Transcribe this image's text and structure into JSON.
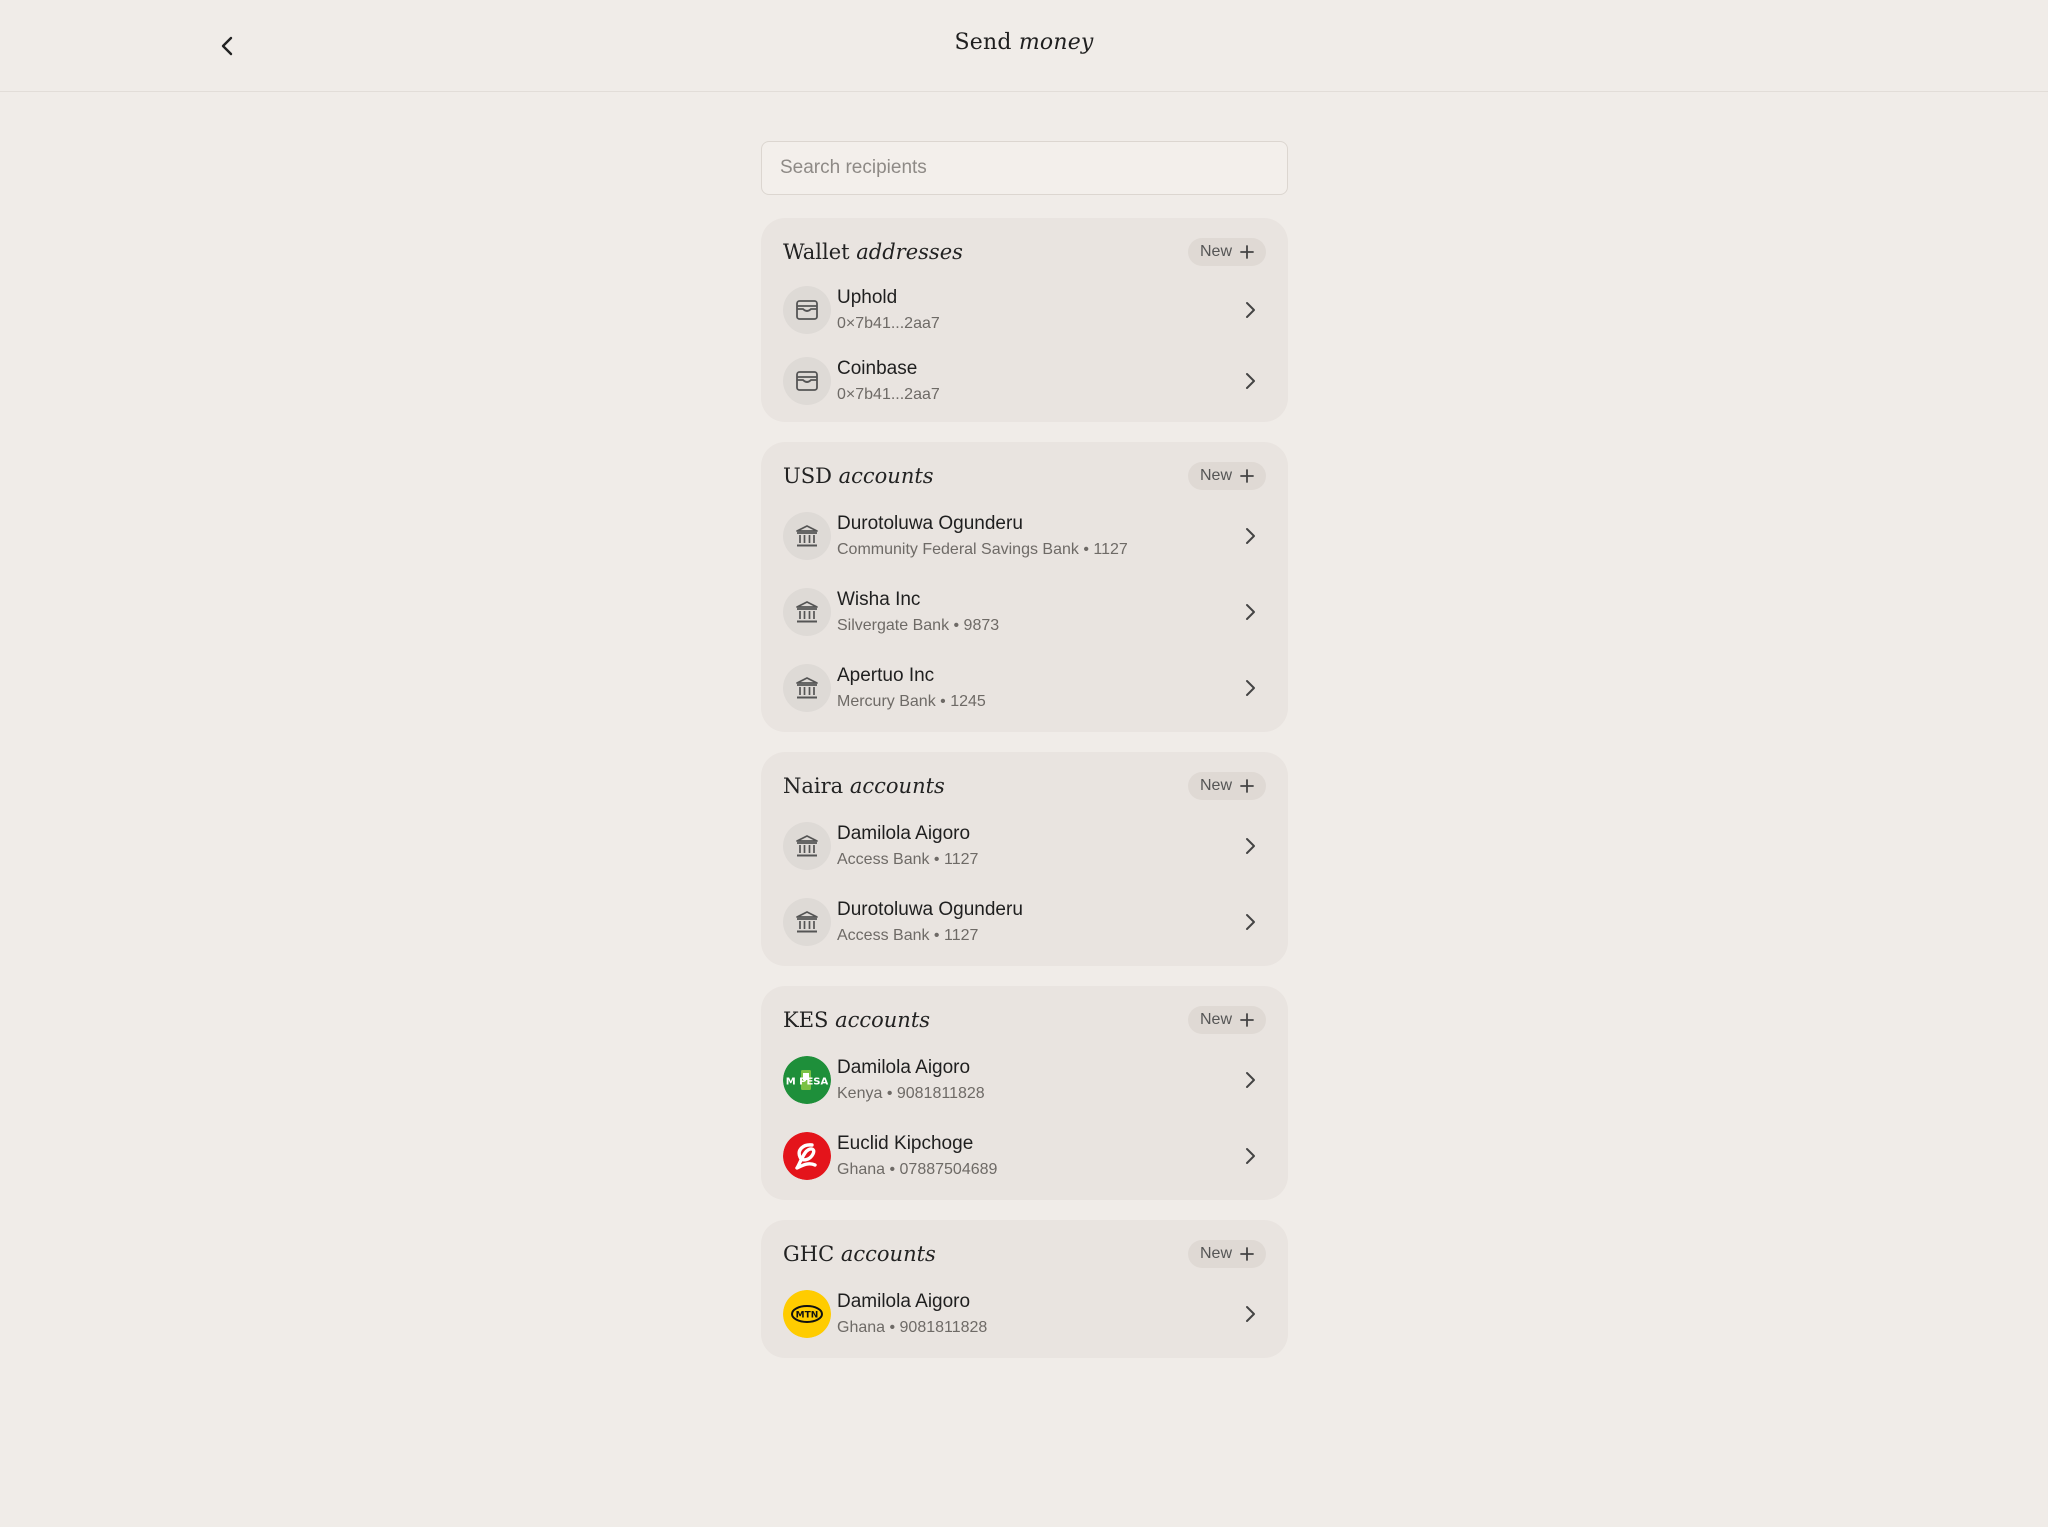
{
  "header": {
    "title_plain": "Send",
    "title_italic": "money"
  },
  "search": {
    "placeholder": "Search recipients"
  },
  "sections": [
    {
      "title_plain": "Wallet",
      "title_italic": "addresses",
      "new_label": "New",
      "items": [
        {
          "name": "Uphold",
          "sub": "0×7b41...2aa7",
          "icon": "wallet-icon"
        },
        {
          "name": "Coinbase",
          "sub": "0×7b41...2aa7",
          "icon": "wallet-icon"
        }
      ]
    },
    {
      "title_plain": "USD",
      "title_italic": "accounts",
      "new_label": "New",
      "items": [
        {
          "name": "Durotoluwa Ogunderu",
          "sub": "Community Federal Savings Bank • 1127",
          "icon": "bank-icon"
        },
        {
          "name": "Wisha Inc",
          "sub": "Silvergate Bank • 9873",
          "icon": "bank-icon"
        },
        {
          "name": "Apertuo Inc",
          "sub": "Mercury Bank • 1245",
          "icon": "bank-icon"
        }
      ]
    },
    {
      "title_plain": "Naira",
      "title_italic": "accounts",
      "new_label": "New",
      "items": [
        {
          "name": "Damilola Aigoro",
          "sub": "Access Bank • 1127",
          "icon": "bank-icon"
        },
        {
          "name": "Durotoluwa Ogunderu",
          "sub": "Access Bank • 1127",
          "icon": "bank-icon"
        }
      ]
    },
    {
      "title_plain": "KES",
      "title_italic": "accounts",
      "new_label": "New",
      "items": [
        {
          "name": "Damilola Aigoro",
          "sub": "Kenya • 9081811828",
          "icon": "mpesa-logo",
          "logo_text": "M PESA"
        },
        {
          "name": "Euclid Kipchoge",
          "sub": "Ghana • 07887504689",
          "icon": "airtel-logo"
        }
      ]
    },
    {
      "title_plain": "GHC",
      "title_italic": "accounts",
      "new_label": "New",
      "items": [
        {
          "name": "Damilola Aigoro",
          "sub": "Ghana • 9081811828",
          "icon": "mtn-logo",
          "logo_text": "MTN"
        }
      ]
    }
  ],
  "colors": {
    "background": "#f0ece8",
    "card": "#e9e4e0",
    "mpesa_green": "#1e8f3a",
    "airtel_red": "#e4141b",
    "mtn_yellow": "#ffcc00"
  }
}
